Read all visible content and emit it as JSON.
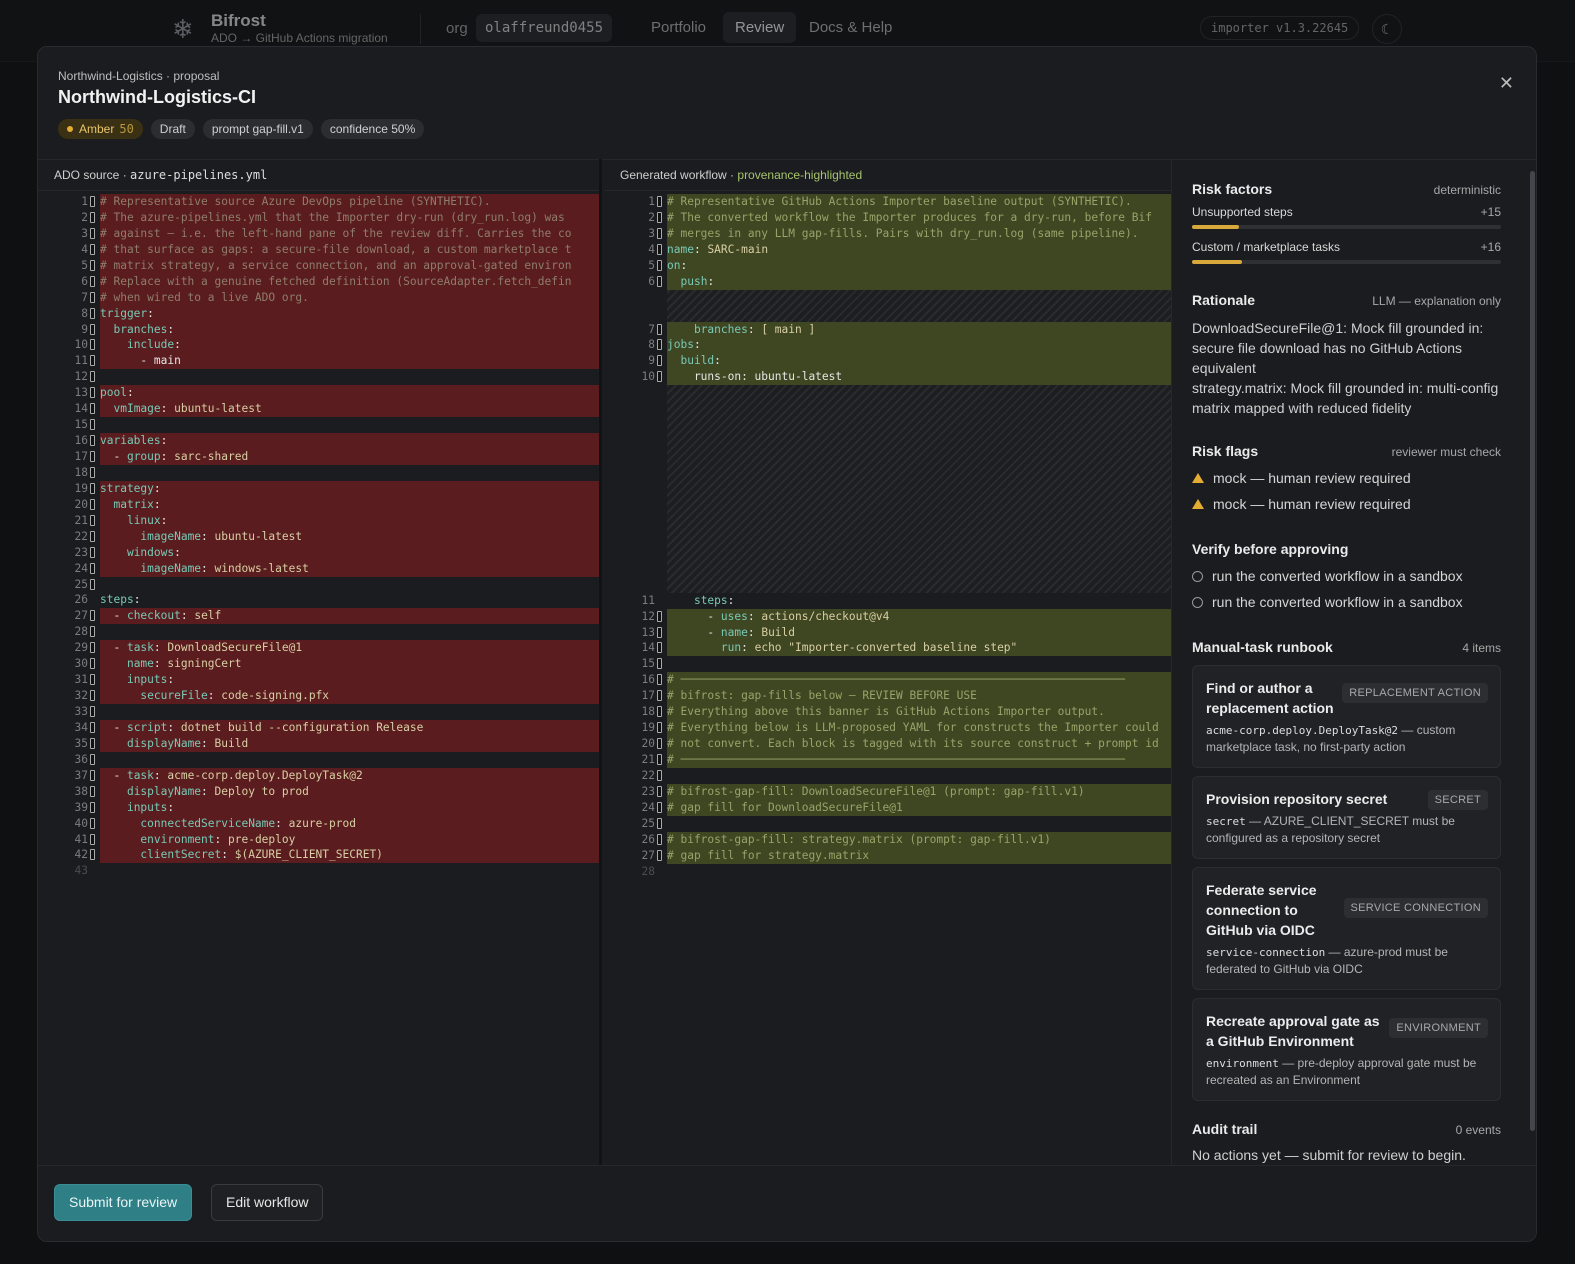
{
  "nav": {
    "brand_name": "Bifrost",
    "brand_sub": "ADO → GitHub Actions migration",
    "org_label": "org",
    "org_value": "olaffreund0455",
    "links": [
      "Portfolio",
      "Review",
      "Docs & Help"
    ],
    "version": "importer v1.3.22645"
  },
  "modal": {
    "breadcrumb": "Northwind-Logistics · proposal",
    "title": "Northwind-Logistics-CI",
    "badges": {
      "risk": "Amber",
      "risk_score": "50",
      "status": "Draft",
      "prompt": "prompt gap-fill.v1",
      "confidence": "confidence 50%"
    }
  },
  "left_pane": {
    "label": "ADO source · ",
    "file": "azure-pipelines.yml",
    "lines": [
      "# Representative source Azure DevOps pipeline (SYNTHETIC).",
      "# The azure-pipelines.yml that the Importer dry-run (dry_run.log) was",
      "# against — i.e. the left-hand pane of the review diff. Carries the co",
      "# that surface as gaps: a secure-file download, a custom marketplace t",
      "# matrix strategy, a service connection, and an approval-gated environ",
      "# Replace with a genuine fetched definition (SourceAdapter.fetch_defin",
      "# when wired to a live ADO org.",
      "trigger:",
      "  branches:",
      "    include:",
      "      - main",
      "",
      "pool:",
      "  vmImage: ubuntu-latest",
      "",
      "variables:",
      "  - group: sarc-shared",
      "",
      "strategy:",
      "  matrix:",
      "    linux:",
      "      imageName: ubuntu-latest",
      "    windows:",
      "      imageName: windows-latest",
      "",
      "steps:",
      "  - checkout: self",
      "",
      "  - task: DownloadSecureFile@1",
      "    name: signingCert",
      "    inputs:",
      "      secureFile: code-signing.pfx",
      "",
      "  - script: dotnet build --configuration Release",
      "    displayName: Build",
      "",
      "  - task: acme-corp.deploy.DeployTask@2",
      "    displayName: Deploy to prod",
      "    inputs:",
      "      connectedServiceName: azure-prod",
      "      environment: pre-deploy",
      "      clientSecret: $(AZURE_CLIENT_SECRET)",
      ""
    ]
  },
  "right_pane": {
    "label": "Generated workflow · ",
    "highlight": "provenance-highlighted",
    "lines": [
      "# Representative GitHub Actions Importer baseline output (SYNTHETIC).",
      "# The converted workflow the Importer produces for a dry-run, before Bif",
      "# merges in any LLM gap-fills. Pairs with dry_run.log (same pipeline).",
      "name: SARC-main",
      "on:",
      "  push:",
      "    branches: [ main ]",
      "jobs:",
      "  build:",
      "    runs-on: ubuntu-latest",
      "    steps:",
      "      - uses: actions/checkout@v4",
      "      - name: Build",
      "        run: echo \"Importer-converted baseline step\"",
      "",
      "# ──────────────────────────────────────────────────────────────────",
      "# bifrost: gap-fills below — REVIEW BEFORE USE",
      "# Everything above this banner is GitHub Actions Importer output.",
      "# Everything below is LLM-proposed YAML for constructs the Importer could",
      "# not convert. Each block is tagged with its source construct + prompt id",
      "# ──────────────────────────────────────────────────────────────────",
      "",
      "# bifrost-gap-fill: DownloadSecureFile@1 (prompt: gap-fill.v1)",
      "# gap fill for DownloadSecureFile@1",
      "",
      "# bifrost-gap-fill: strategy.matrix (prompt: gap-fill.v1)",
      "# gap fill for strategy.matrix",
      ""
    ]
  },
  "sidebar": {
    "risk_factors": {
      "title": "Risk factors",
      "meta": "deterministic",
      "items": [
        {
          "label": "Unsupported steps",
          "delta": "+15",
          "level": 0.15
        },
        {
          "label": "Custom / marketplace tasks",
          "delta": "+16",
          "level": 0.16
        }
      ]
    },
    "rationale": {
      "title": "Rationale",
      "meta": "LLM — explanation only",
      "lines": [
        "DownloadSecureFile@1: Mock fill grounded in: secure file download has no GitHub Actions equivalent",
        "strategy.matrix: Mock fill grounded in: multi-config matrix mapped with reduced fidelity"
      ]
    },
    "risk_flags": {
      "title": "Risk flags",
      "meta": "reviewer must check",
      "items": [
        "mock — human review required",
        "mock — human review required"
      ]
    },
    "verify": {
      "title": "Verify before approving",
      "items": [
        "run the converted workflow in a sandbox",
        "run the converted workflow in a sandbox"
      ]
    },
    "runbook": {
      "title": "Manual-task runbook",
      "meta": "4 items",
      "cards": [
        {
          "title": "Find or author a replacement action",
          "tag": "REPLACEMENT ACTION",
          "code": "acme-corp.deploy.DeployTask@2",
          "desc": " — custom marketplace task, no first-party action"
        },
        {
          "title": "Provision repository secret",
          "tag": "SECRET",
          "code": "secret",
          "desc": " — AZURE_CLIENT_SECRET must be configured as a repository secret"
        },
        {
          "title": "Federate service connection to GitHub via OIDC",
          "tag": "SERVICE CONNECTION",
          "code": "service-connection",
          "desc": " — azure-prod must be federated to GitHub via OIDC"
        },
        {
          "title": "Recreate approval gate as a GitHub Environment",
          "tag": "ENVIRONMENT",
          "code": "environment",
          "desc": " — pre-deploy approval gate must be recreated as an Environment"
        }
      ]
    },
    "audit": {
      "title": "Audit trail",
      "meta": "0 events",
      "empty": "No actions yet — submit for review to begin."
    }
  },
  "footer": {
    "submit": "Submit for review",
    "edit": "Edit workflow"
  },
  "colors": {
    "accent": "#2f7f86",
    "amber": "#e3ac32",
    "deleted": "#5a1c1e",
    "added": "#3f4622"
  }
}
